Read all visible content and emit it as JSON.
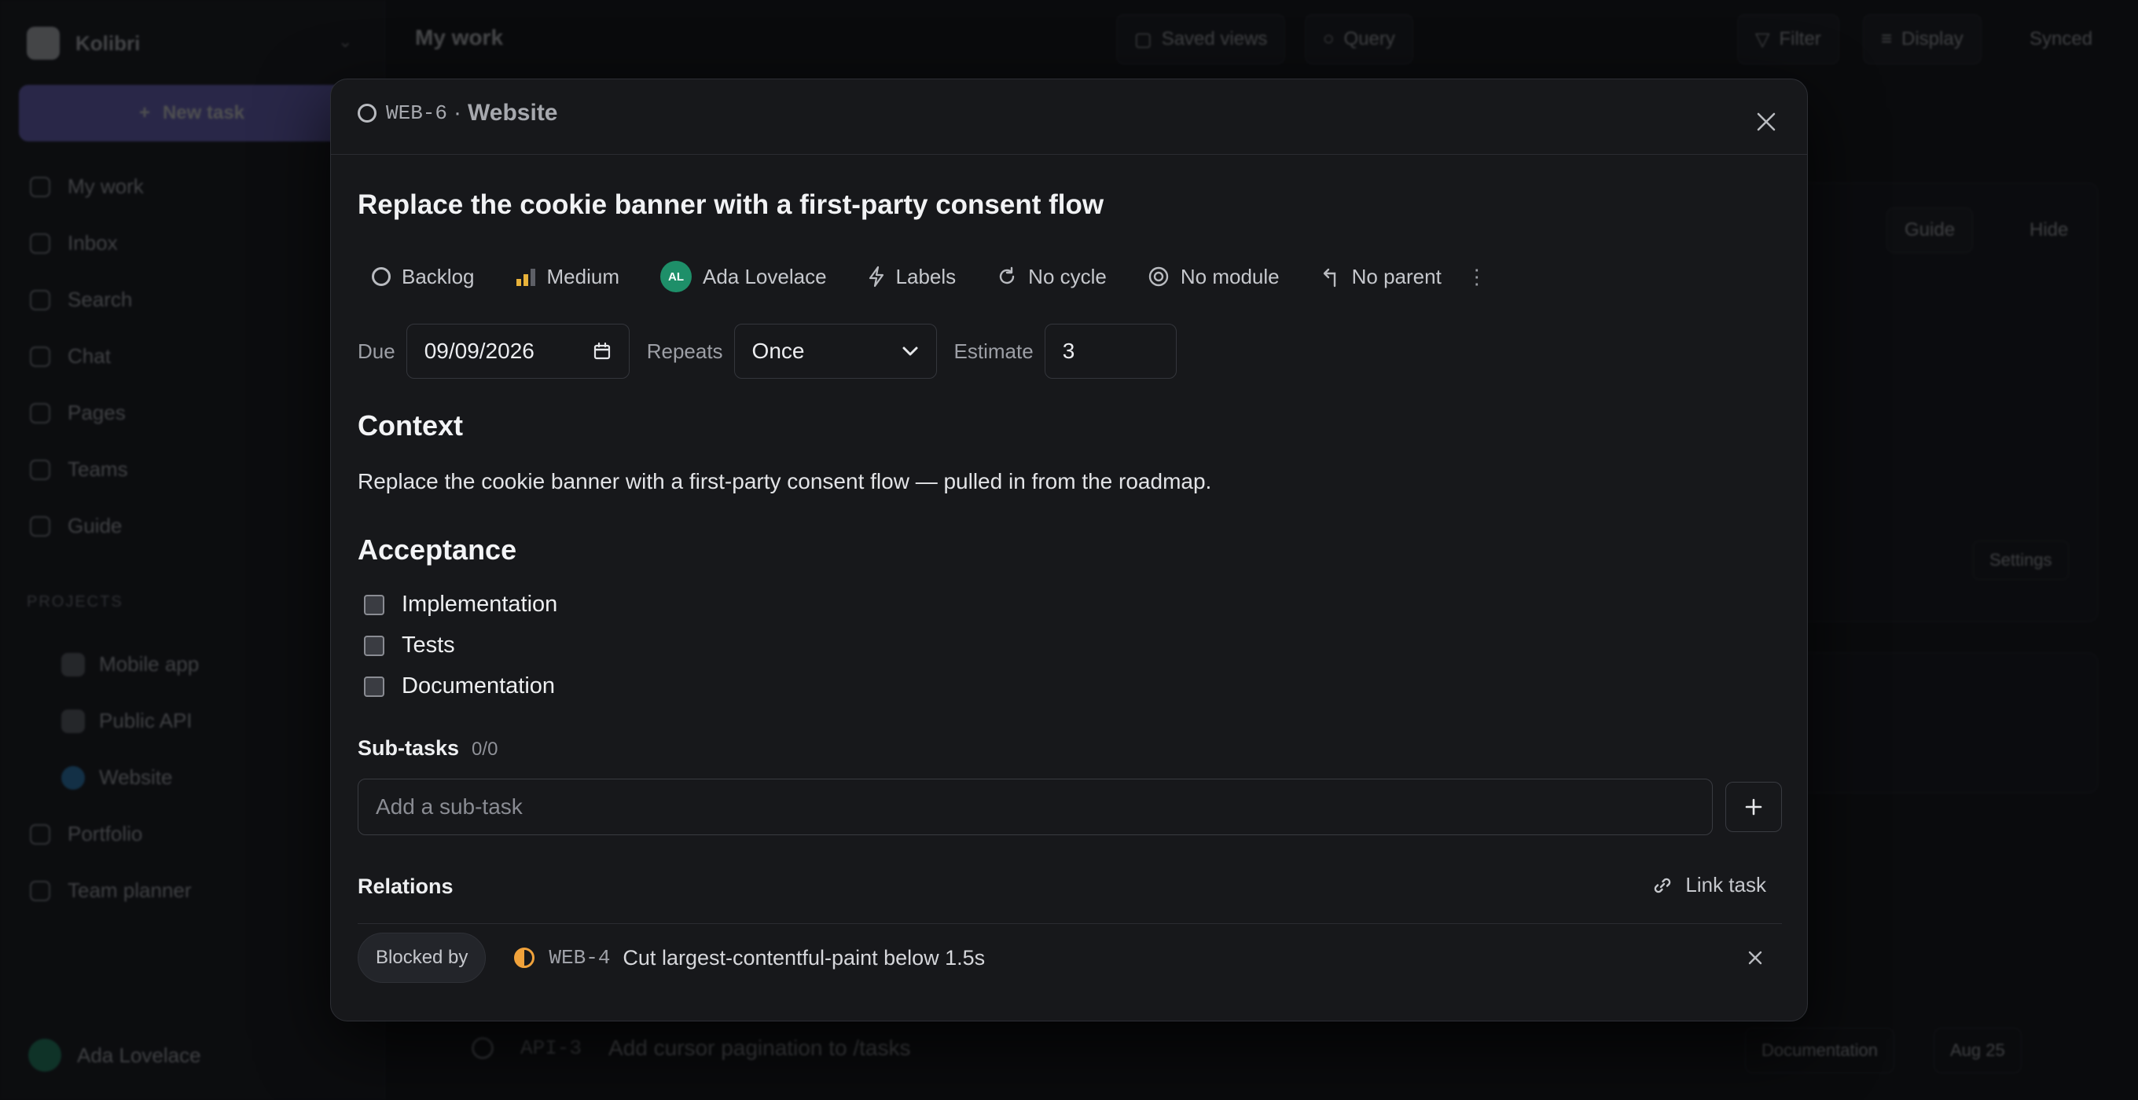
{
  "background": {
    "workspace_name": "Kolibri",
    "new_task_label": "New task",
    "nav": [
      "My work",
      "Inbox",
      "Search",
      "Chat",
      "Pages",
      "Teams",
      "Guide"
    ],
    "projects_heading": "PROJECTS",
    "projects": [
      "Mobile app",
      "Public API",
      "Website"
    ],
    "nav_extra": [
      "Portfolio",
      "Team planner"
    ],
    "user_name": "Ada Lovelace",
    "page_title": "My work",
    "toolbar": [
      "Saved views",
      "Query",
      "Filter",
      "Display",
      "Synced"
    ],
    "panel_buttons": [
      "Guide",
      "Hide"
    ],
    "settings_label": "Settings",
    "bg_row_id": "API-3",
    "bg_row_title": "Add cursor pagination to /tasks",
    "bg_row_tag": "Documentation",
    "bg_row_date": "Aug 25"
  },
  "modal": {
    "issue_id": "WEB-6",
    "separator": "·",
    "project": "Website",
    "title": "Replace the cookie banner with a first-party consent flow",
    "properties": {
      "status": "Backlog",
      "priority": "Medium",
      "assignee_initials": "AL",
      "assignee": "Ada Lovelace",
      "labels": "Labels",
      "cycle": "No cycle",
      "module": "No module",
      "parent": "No parent",
      "more": "⋮"
    },
    "fields": {
      "due_label": "Due",
      "due_value": "09/09/2026",
      "repeats_label": "Repeats",
      "repeats_value": "Once",
      "estimate_label": "Estimate",
      "estimate_value": "3"
    },
    "context_heading": "Context",
    "context_text": "Replace the cookie banner with a first-party consent flow — pulled in from the roadmap.",
    "acceptance_heading": "Acceptance",
    "acceptance_items": [
      "Implementation",
      "Tests",
      "Documentation"
    ],
    "subtasks_heading": "Sub-tasks",
    "subtasks_count": "0/0",
    "subtask_placeholder": "Add a sub-task",
    "relations_heading": "Relations",
    "link_task_label": "Link task",
    "relation": {
      "type": "Blocked by",
      "id": "WEB-4",
      "title": "Cut largest-contentful-paint below 1.5s"
    }
  },
  "colors": {
    "modal_bg": "#17181b",
    "assignee_avatar": "#1e8f69",
    "priority_medium": "#e8b23a",
    "in_progress_status": "#f0a23b",
    "accent_new_task": "#7b72e0"
  }
}
